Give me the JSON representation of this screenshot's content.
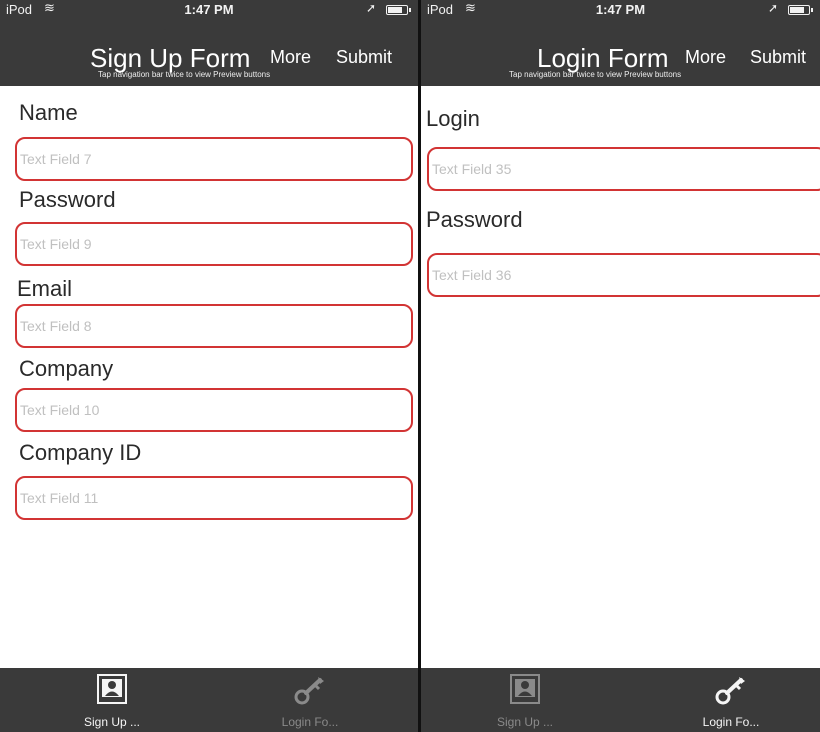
{
  "status_bar": {
    "carrier": "iPod",
    "time": "1:47 PM"
  },
  "screens": [
    {
      "nav": {
        "title": "Sign Up Form",
        "more": "More",
        "submit": "Submit",
        "hint": "Tap navigation bar twice to view Preview buttons"
      },
      "fields": [
        {
          "label": "Name",
          "placeholder": "Text Field 7"
        },
        {
          "label": "Password",
          "placeholder": "Text Field 9"
        },
        {
          "label": "Email",
          "placeholder": "Text Field 8"
        },
        {
          "label": "Company",
          "placeholder": "Text Field 10"
        },
        {
          "label": "Company ID",
          "placeholder": "Text Field 11"
        }
      ],
      "tabs": [
        {
          "label": "Sign Up ...",
          "icon": "person-portrait-icon",
          "active": true
        },
        {
          "label": "Login Fo...",
          "icon": "key-icon",
          "active": false
        }
      ]
    },
    {
      "nav": {
        "title": "Login Form",
        "more": "More",
        "submit": "Submit",
        "hint": "Tap navigation bar twice to view Preview buttons"
      },
      "fields": [
        {
          "label": "Login",
          "placeholder": "Text Field 35"
        },
        {
          "label": "Password",
          "placeholder": "Text Field 36"
        }
      ],
      "tabs": [
        {
          "label": "Sign Up ...",
          "icon": "person-portrait-icon",
          "active": false
        },
        {
          "label": "Login Fo...",
          "icon": "key-icon",
          "active": true
        }
      ]
    }
  ],
  "colors": {
    "bar_background": "#3a3a3a",
    "field_border": "#d23434",
    "placeholder_text": "#c0c0c0"
  }
}
